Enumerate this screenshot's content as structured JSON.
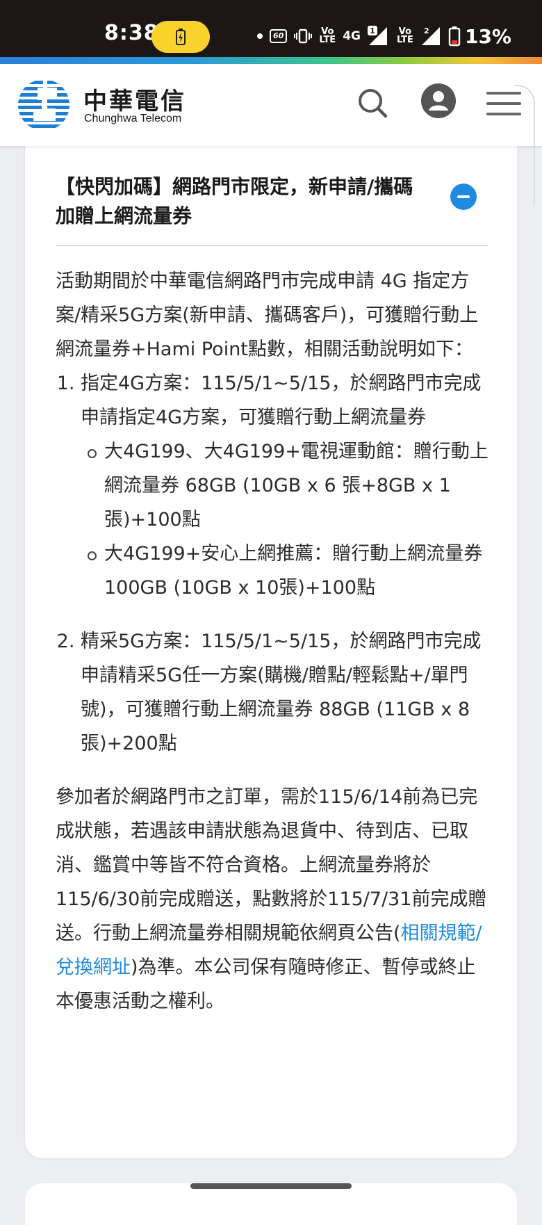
{
  "status_bar": {
    "time": "8:38",
    "network": "4G",
    "sim1": "1",
    "sim2": "2",
    "refresh": "60",
    "volte": "VoLTE",
    "battery": "13%"
  },
  "header": {
    "brand_cn": "中華電信",
    "brand_en": "Chunghwa Telecom"
  },
  "card": {
    "title": "【快閃加碼】網路門市限定，新申請/攜碼加贈上網流量券",
    "intro": "活動期間於中華電信網路門市完成申請 4G 指定方案/精采5G方案(新申請、攜碼客戶)，可獲贈行動上網流量券+Hami Point點數，相關活動說明如下：",
    "items": [
      {
        "text": "指定4G方案：115/5/1~5/15，於網路門市完成申請指定4G方案，可獲贈行動上網流量券",
        "sub": [
          "大4G199、大4G199+電視運動館：贈行動上網流量券 68GB (10GB x 6 張+8GB x 1張)+100點",
          "大4G199+安心上網推薦：贈行動上網流量券 100GB (10GB x 10張)+100點"
        ]
      },
      {
        "text": "精采5G方案：115/5/1~5/15，於網路門市完成申請精采5G任一方案(購機/贈點/輕鬆點+/單門號)，可獲贈行動上網流量券 88GB (11GB x 8張)+200點"
      }
    ],
    "para_before_link": "參加者於網路門市之訂單，需於115/6/14前為已完成狀態，若遇該申請狀態為退貨中、待到店、已取消、鑑賞中等皆不符合資格。上網流量券將於115/6/30前完成贈送，點數將於115/7/31前完成贈送。行動上網流量券相關規範依網頁公告(",
    "link_text": "相關規範/兌換網址",
    "para_after_link": ")為準。本公司保有隨時修正、暫停或終止本優惠活動之權利。"
  },
  "colors": {
    "accent": "#1e8be0",
    "statusbar": "#1c1715",
    "pill": "#f9d32b"
  }
}
